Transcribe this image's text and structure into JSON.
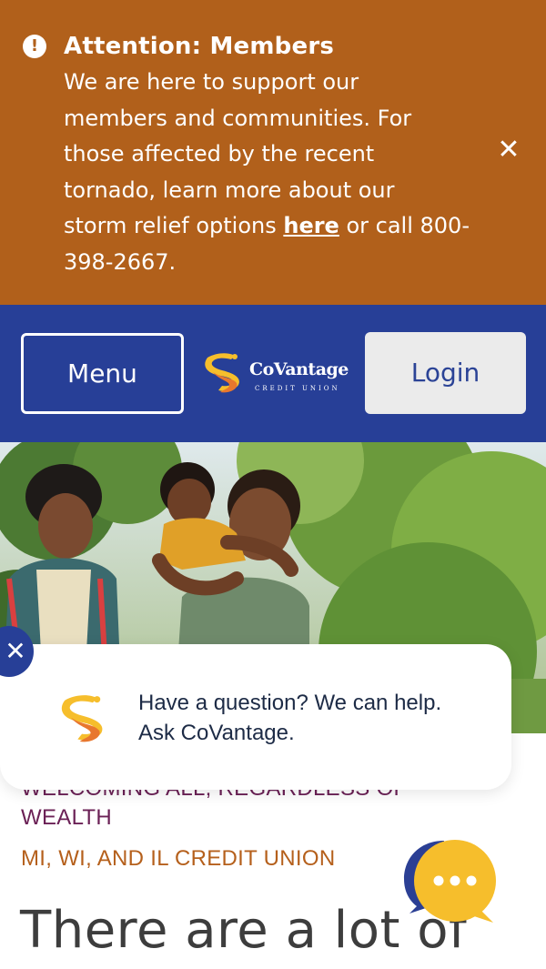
{
  "alert": {
    "icon": "exclamation-circle-icon",
    "title": "Attention: Members",
    "body_lines": [
      "We are here to support our",
      "members and communities. For",
      "those affected by the recent",
      "tornado, learn more about our"
    ],
    "body_before_link": "storm relief options ",
    "link_text": "here",
    "body_after_link": " or call 800-",
    "body_last": "398-2667.",
    "close_icon": "close-icon",
    "background": "#b1601b"
  },
  "header": {
    "menu_label": "Menu",
    "login_label": "Login",
    "logo_name": "CoVantage",
    "logo_subtitle": "CREDIT UNION",
    "background": "#273f97"
  },
  "hero": {
    "image_subject": "family-outdoors-photo"
  },
  "main": {
    "tagline_partial": "WELCOMING ALL, REGARDLESS OF",
    "tagline_line2": "WEALTH",
    "region_tagline": "MI, WI, AND IL CREDIT UNION",
    "heading": "There are a lot of"
  },
  "chat": {
    "message": "Have a question? We can help. Ask CoVantage.",
    "close_icon": "close-icon",
    "launcher_icon": "chat-bubble-icon",
    "brand_orange": "#f0a020",
    "brand_yellow": "#f6be2c"
  }
}
